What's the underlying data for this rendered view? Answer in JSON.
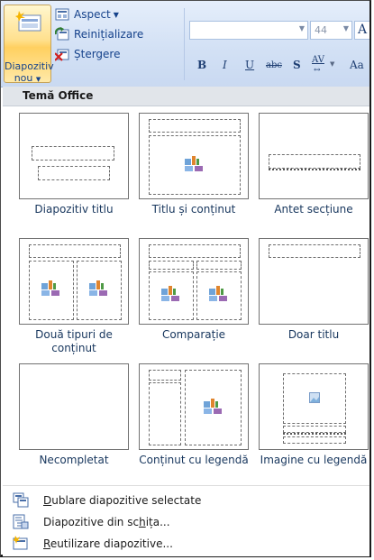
{
  "ribbon": {
    "new_slide_line1": "Diapozitiv",
    "new_slide_line2": "nou",
    "layout_btn": "Aspect",
    "reset_btn": "Reinițializare",
    "delete_btn": "Ștergere",
    "font_size": "44",
    "bold": "B",
    "italic": "I",
    "underline": "U",
    "strike": "abc",
    "shadow": "S",
    "spacing": "AV",
    "grow": "A",
    "case": "Aa"
  },
  "gallery": {
    "header": "Temă Office",
    "layouts": [
      {
        "label": "Diapozitiv titlu"
      },
      {
        "label": "Titlu și conținut"
      },
      {
        "label": "Antet secțiune"
      },
      {
        "label": "Două tipuri de conținut"
      },
      {
        "label": "Comparație"
      },
      {
        "label": "Doar titlu"
      },
      {
        "label": "Necompletat"
      },
      {
        "label": "Conținut cu legendă"
      },
      {
        "label": "Imagine cu legendă"
      }
    ]
  },
  "menu": {
    "duplicate_pre": "",
    "duplicate_u": "D",
    "duplicate_rest": "ublare diapozitive selectate",
    "outline_pre": "Diapozitive din sc",
    "outline_u": "h",
    "outline_rest": "ița...",
    "reuse_pre": "",
    "reuse_u": "R",
    "reuse_rest": "eutilizare diapozitive..."
  }
}
